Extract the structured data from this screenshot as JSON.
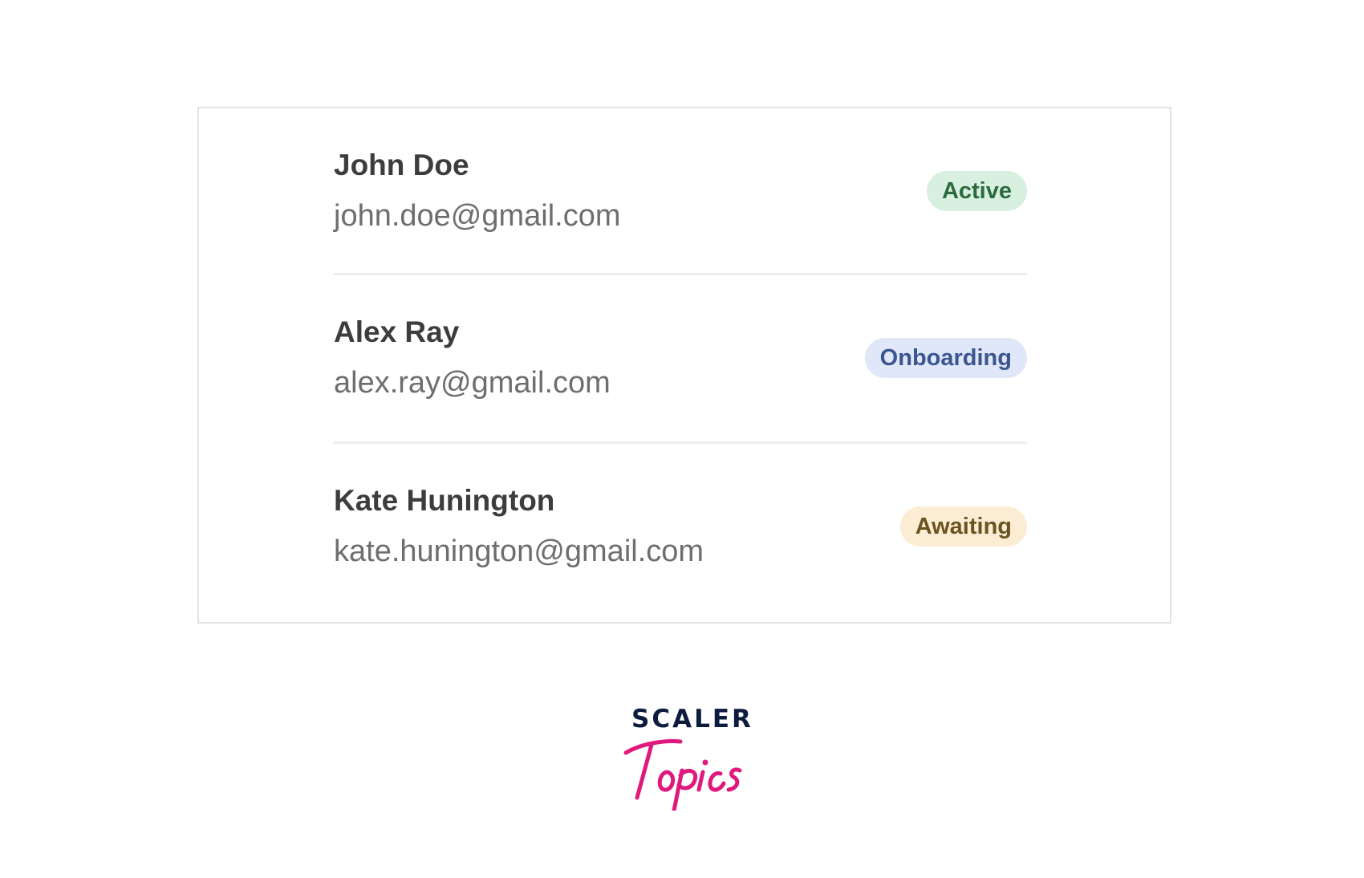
{
  "users": [
    {
      "name": "John Doe",
      "email": "john.doe@gmail.com",
      "status": "Active",
      "status_color": "#d7f0df"
    },
    {
      "name": "Alex Ray",
      "email": "alex.ray@gmail.com",
      "status": "Onboarding",
      "status_color": "#e0e7f8"
    },
    {
      "name": "Kate Hunington",
      "email": "kate.hunington@gmail.com",
      "status": "Awaiting",
      "status_color": "#fbedd3"
    }
  ],
  "logo": {
    "brand": "SCALER",
    "subbrand": "Topics",
    "brand_color": "#0d1b3e",
    "accent_color": "#e0197d"
  }
}
